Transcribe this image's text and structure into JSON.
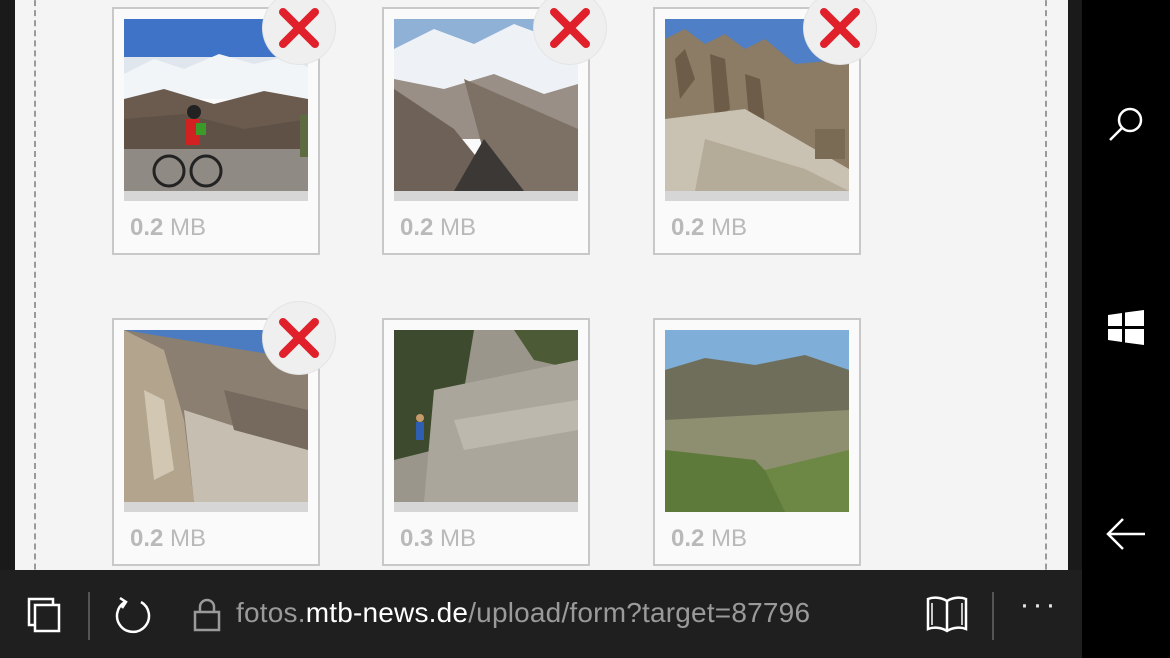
{
  "upload": {
    "items": [
      {
        "size_value": "0.2",
        "size_unit": " MB",
        "removable": true
      },
      {
        "size_value": "0.2",
        "size_unit": " MB",
        "removable": true
      },
      {
        "size_value": "0.2",
        "size_unit": " MB",
        "removable": true
      },
      {
        "size_value": "0.2",
        "size_unit": " MB",
        "removable": true
      },
      {
        "size_value": "0.3",
        "size_unit": " MB",
        "removable": false
      },
      {
        "size_value": "0.2",
        "size_unit": " MB",
        "removable": false
      }
    ]
  },
  "address_bar": {
    "url_prefix": "fotos.",
    "url_host": "mtb-news.de",
    "url_path": "/upload/form?target=87796"
  },
  "toolbar": {
    "tabs_icon": "tabs-icon",
    "refresh_icon": "refresh-icon",
    "lock_icon": "lock-icon",
    "reading_view_icon": "reading-view-icon",
    "more_label": "···"
  },
  "nav_bar": {
    "search_icon": "search-icon",
    "windows_icon": "windows-icon",
    "back_icon": "back-arrow-icon"
  },
  "colors": {
    "remove_x": "#e0202a",
    "bar_bg": "#1f1f1f"
  }
}
